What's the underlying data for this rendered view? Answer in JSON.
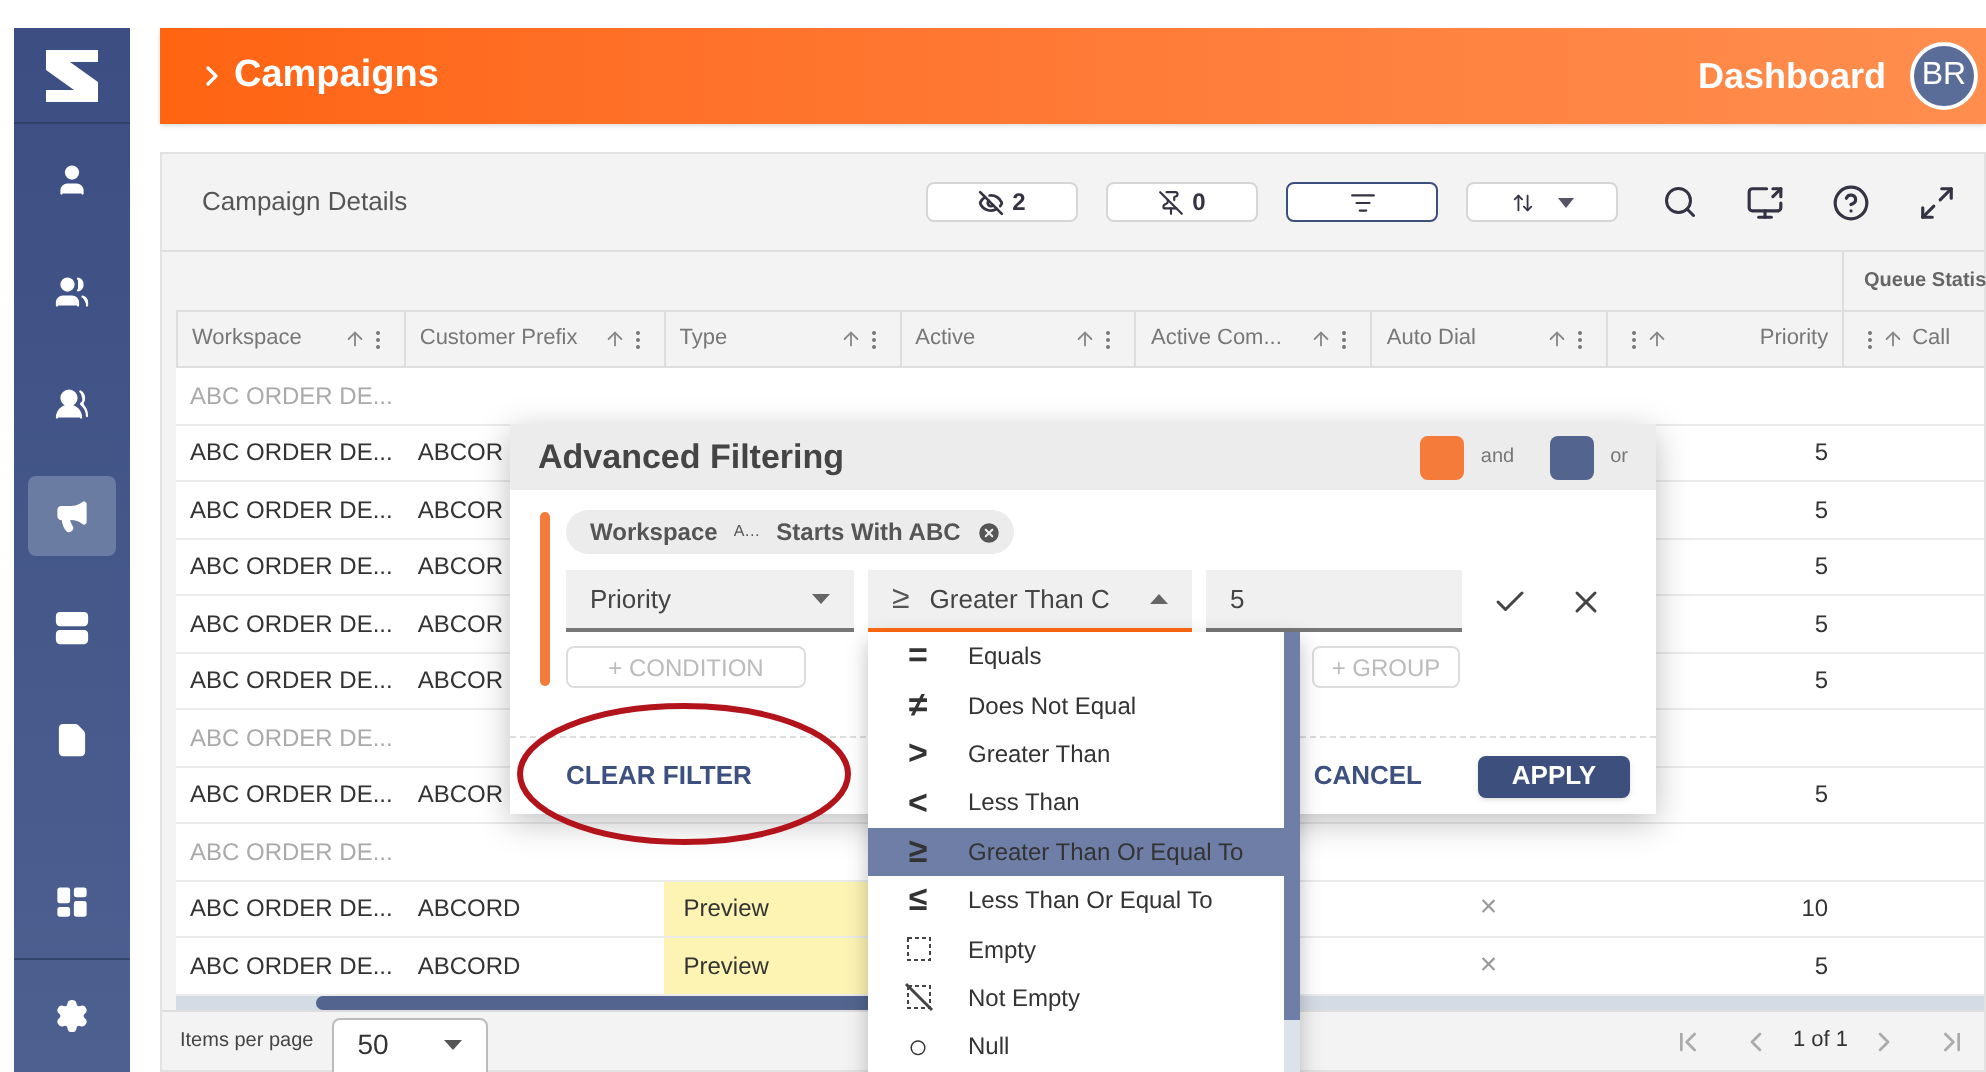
{
  "sidebar": {
    "items": [
      {
        "kind": "person",
        "selected": false
      },
      {
        "kind": "people",
        "selected": false
      },
      {
        "kind": "group",
        "selected": false
      },
      {
        "kind": "megaphone",
        "selected": true
      },
      {
        "kind": "server",
        "selected": false
      },
      {
        "kind": "document",
        "selected": false
      }
    ],
    "bottom_items": [
      {
        "kind": "dashboard",
        "selected": false
      },
      {
        "kind": "settings",
        "selected": false
      }
    ]
  },
  "header": {
    "title": "Campaigns",
    "link": "Dashboard",
    "avatar": "BR"
  },
  "panel": {
    "title": "Campaign Details",
    "toolbar": [
      {
        "kind": "hidden",
        "count": "2",
        "active": false
      },
      {
        "kind": "pinned",
        "count": "0",
        "active": false
      },
      {
        "kind": "filter",
        "active": true
      },
      {
        "kind": "sort",
        "active": false
      }
    ]
  },
  "table": {
    "group_header": "Queue Statis",
    "columns": [
      {
        "label": "Workspace",
        "icons_first": false
      },
      {
        "label": "Customer Prefix",
        "icons_first": false
      },
      {
        "label": "Type",
        "icons_first": false
      },
      {
        "label": "Active",
        "icons_first": false
      },
      {
        "label": "Active Com...",
        "icons_first": false
      },
      {
        "label": "Auto Dial",
        "icons_first": false
      },
      {
        "label": "Priority",
        "icons_first": true
      },
      {
        "label": "Call",
        "icons_first": true
      }
    ],
    "rows": [
      {
        "workspace": "ABC ORDER DE...",
        "muted": true
      },
      {
        "workspace": "ABC ORDER DE...",
        "prefix": "ABCOR",
        "priority": "5",
        "muted": false
      },
      {
        "workspace": "ABC ORDER DE...",
        "prefix": "ABCOR",
        "priority": "5",
        "muted": false
      },
      {
        "workspace": "ABC ORDER DE...",
        "prefix": "ABCOR",
        "priority": "5",
        "muted": false
      },
      {
        "workspace": "ABC ORDER DE...",
        "prefix": "ABCOR",
        "priority": "5",
        "muted": false
      },
      {
        "workspace": "ABC ORDER DE...",
        "prefix": "ABCOR",
        "priority": "5",
        "muted": false
      },
      {
        "workspace": "ABC ORDER DE...",
        "muted": true
      },
      {
        "workspace": "ABC ORDER DE...",
        "prefix": "ABCOR",
        "priority": "5",
        "muted": false
      },
      {
        "workspace": "ABC ORDER DE...",
        "muted": true
      },
      {
        "workspace": "ABC ORDER DE...",
        "prefix": "ABCORD",
        "type": "Preview",
        "auto_dial": "×",
        "priority": "10",
        "muted": false
      },
      {
        "workspace": "ABC ORDER DE...",
        "prefix": "ABCORD",
        "type": "Preview",
        "auto_dial": "×",
        "priority": "5",
        "muted": false
      }
    ],
    "footer": {
      "items_per_page_label": "Items per page",
      "items_per_page": "50",
      "page": "1 of 1"
    }
  },
  "dialog": {
    "title": "Advanced Filtering",
    "legend": [
      {
        "label": "and",
        "color": "#f47b3a"
      },
      {
        "label": "or",
        "color": "#53658e"
      }
    ],
    "chip": {
      "field": "Workspace",
      "operator_icon": "A…",
      "text": "Starts With ABC"
    },
    "field_select": "Priority",
    "operator_symbol": "≥",
    "operator_select": "Greater Than C",
    "value": "5",
    "condition_button": "+ CONDITION",
    "group_button": "+ GROUP",
    "clear_button": "CLEAR FILTER",
    "cancel_button": "CANCEL",
    "apply_button": "APPLY"
  },
  "dropdown": {
    "items": [
      {
        "symbol": "=",
        "label": "Equals",
        "selected": false
      },
      {
        "symbol": "≠",
        "label": "Does Not Equal",
        "selected": false
      },
      {
        "symbol": ">",
        "label": "Greater Than",
        "selected": false
      },
      {
        "symbol": "<",
        "label": "Less Than",
        "selected": false
      },
      {
        "symbol": "≥",
        "label": "Greater Than Or Equal To",
        "selected": true
      },
      {
        "symbol": "≤",
        "label": "Less Than Or Equal To",
        "selected": false
      },
      {
        "kind": "empty",
        "label": "Empty",
        "selected": false
      },
      {
        "kind": "not_empty",
        "label": "Not Empty",
        "selected": false
      },
      {
        "symbol": "○",
        "label": "Null",
        "selected": false
      }
    ]
  }
}
